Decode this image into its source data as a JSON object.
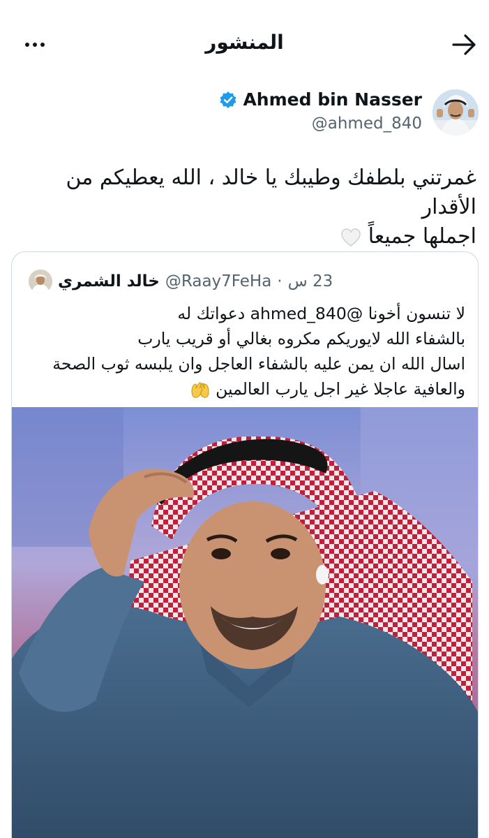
{
  "header": {
    "title": "المنشور",
    "back_icon": "arrow-right-icon",
    "more_icon": "more-horizontal-icon"
  },
  "post": {
    "author": {
      "display_name": "Ahmed bin Nasser",
      "handle": "@ahmed_840",
      "verified": true,
      "verified_color": "#1d9bf0"
    },
    "text": "غمرتني بلطفك وطيبك يا خالد ، الله يعطيكم من الأقدار\nاجملها جميعاً",
    "emoji": "white-heart-icon"
  },
  "quoted_post": {
    "author": {
      "display_name": "خالد الشمري",
      "handle": "@Raay7FeHa",
      "time": "23 س"
    },
    "lines": [
      "لا تنسون أخونا  @ahmed_840 دعواتك له",
      "بالشفاء الله لايوريكم مكروه بغالي أو قريب يارب",
      "اسال الله ان يمن عليه بالشفاء العاجل وان يلبسه ثوب الصحة",
      "والعافية عاجلا غير اجل يارب العالمين"
    ],
    "emoji": "raised-hands-icon",
    "image": "photo-man-in-red-shemagh"
  },
  "colors": {
    "text": "#0f1419",
    "secondary": "#536471",
    "border": "#cfd9de"
  }
}
